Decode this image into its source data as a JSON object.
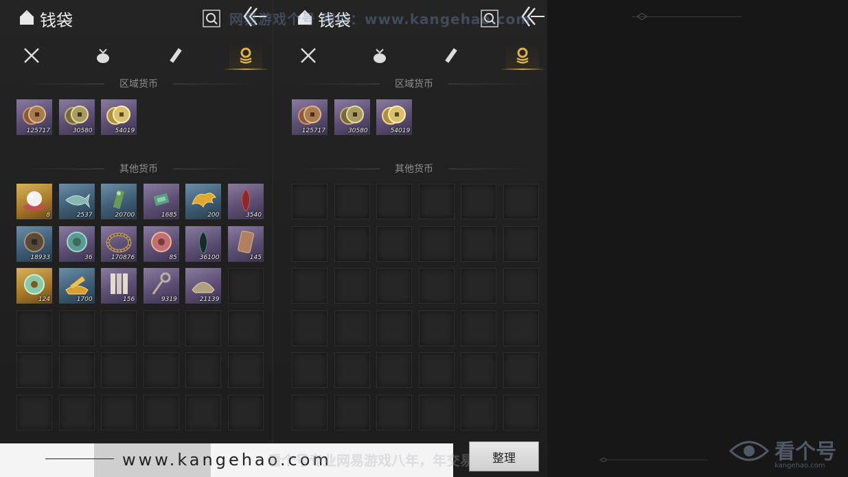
{
  "panels": [
    {
      "title": "钱袋",
      "sections": {
        "regional": "区域货币",
        "other": "其他货币"
      },
      "regional_items": [
        {
          "qty": "125717",
          "icon": "copper-coin-icon",
          "rarity": "purple"
        },
        {
          "qty": "30580",
          "icon": "bronze-coin-icon",
          "rarity": "purple"
        },
        {
          "qty": "54019",
          "icon": "gold-coin-icon",
          "rarity": "purple"
        }
      ],
      "other_items": [
        {
          "qty": "8",
          "icon": "pearl-icon",
          "rarity": "gold"
        },
        {
          "qty": "2537",
          "icon": "jade-fish-icon",
          "rarity": "blue"
        },
        {
          "qty": "20700",
          "icon": "green-talisman-icon",
          "rarity": "blue"
        },
        {
          "qty": "1685",
          "icon": "jade-charm-icon",
          "rarity": "purple"
        },
        {
          "qty": "200",
          "icon": "golden-dragon-icon",
          "rarity": "blue"
        },
        {
          "qty": "3540",
          "icon": "red-feather-icon",
          "rarity": "purple"
        },
        {
          "qty": "18933",
          "icon": "ancient-coin-icon",
          "rarity": "blue"
        },
        {
          "qty": "36",
          "icon": "jade-medallion-icon",
          "rarity": "purple"
        },
        {
          "qty": "170876",
          "icon": "bracelet-icon",
          "rarity": "purple"
        },
        {
          "qty": "85",
          "icon": "red-medallion-icon",
          "rarity": "purple"
        },
        {
          "qty": "36100",
          "icon": "dark-feather-icon",
          "rarity": "purple"
        },
        {
          "qty": "145",
          "icon": "tablet-icon",
          "rarity": "purple"
        },
        {
          "qty": "124",
          "icon": "jade-ring-icon",
          "rarity": "gold"
        },
        {
          "qty": "1700",
          "icon": "gold-ingot-icon",
          "rarity": "blue"
        },
        {
          "qty": "156",
          "icon": "bamboo-slips-icon",
          "rarity": "purple"
        },
        {
          "qty": "9319",
          "icon": "key-icon",
          "rarity": "purple"
        },
        {
          "qty": "21139",
          "icon": "silver-ingot-icon",
          "rarity": "purple"
        }
      ],
      "empty_slots": 19
    },
    {
      "title": "钱袋",
      "sections": {
        "regional": "区域货币",
        "other": "其他货币"
      },
      "regional_items": [
        {
          "qty": "125717",
          "icon": "copper-coin-icon",
          "rarity": "purple"
        },
        {
          "qty": "30580",
          "icon": "bronze-coin-icon",
          "rarity": "purple"
        },
        {
          "qty": "54019",
          "icon": "gold-coin-icon",
          "rarity": "purple"
        }
      ],
      "other_items": [],
      "empty_slots": 36
    }
  ],
  "watermark_top": "网易游戏个号  网址：www.kangehao.com",
  "watermark_bottom": "看个号专业网易游戏八年，年交易额过百亿",
  "footer_url": "www.kangehao.com",
  "sort_button": "整理",
  "logo": {
    "text": "看个号",
    "sub": "kangehao.com"
  },
  "colors": {
    "accent_gold": "#caa24a",
    "purple": "#6e5e86",
    "blue": "#4a6a84",
    "gold": "#b88a34"
  }
}
